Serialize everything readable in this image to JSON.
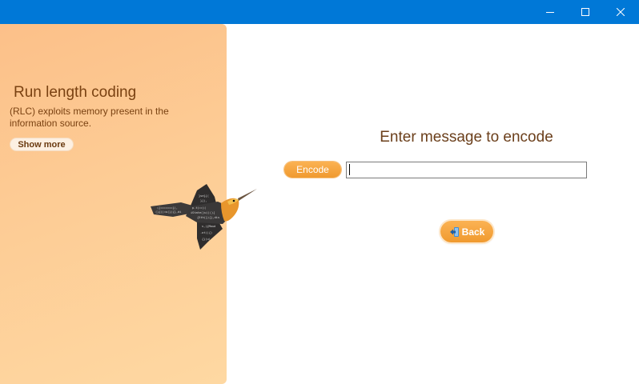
{
  "window": {
    "controls": {
      "minimize_icon": "minimize-icon",
      "maximize_icon": "maximize-icon",
      "close_icon": "close-icon"
    },
    "titlebar_color": "#0078d7"
  },
  "sidebar": {
    "title": "Run length coding",
    "description": "(RLC) exploits memory present in the information source.",
    "show_more_label": "Show more",
    "illustration": "hummingbird-code-illustration",
    "gradient_colors": [
      "#fcc089",
      "#fed8a2"
    ]
  },
  "main": {
    "heading": "Enter message to encode",
    "encode_label": "Encode",
    "message_value": "",
    "back_label": "Back",
    "back_icon": "back-arrow-icon",
    "accent_color": "#f09a2f"
  }
}
